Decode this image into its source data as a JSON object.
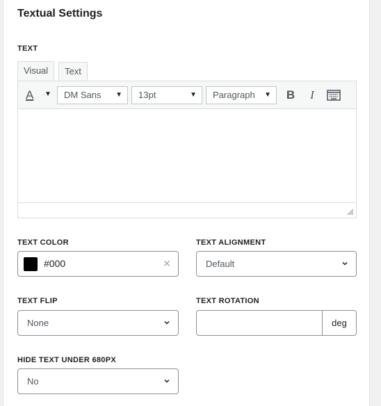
{
  "panel": {
    "title": "Textual Settings"
  },
  "text_section": {
    "label": "TEXT",
    "tabs": [
      {
        "label": "Visual"
      },
      {
        "label": "Text"
      }
    ],
    "toolbar": {
      "text_color_icon": "A",
      "font_family": "DM Sans",
      "font_size": "13pt",
      "format": "Paragraph",
      "bold": "B",
      "italic": "I"
    },
    "content": ""
  },
  "text_color": {
    "label": "TEXT COLOR",
    "value": "#000",
    "swatch": "#000000"
  },
  "text_alignment": {
    "label": "TEXT ALIGNMENT",
    "value": "Default"
  },
  "text_flip": {
    "label": "TEXT FLIP",
    "value": "None"
  },
  "text_rotation": {
    "label": "TEXT ROTATION",
    "value": "",
    "unit": "deg"
  },
  "hide_text": {
    "label": "HIDE TEXT UNDER 680PX",
    "value": "No"
  },
  "colors": {
    "accent": "#1e1e1e",
    "border": "#8c8f94",
    "toolbar_bg": "#f6f7f7"
  }
}
